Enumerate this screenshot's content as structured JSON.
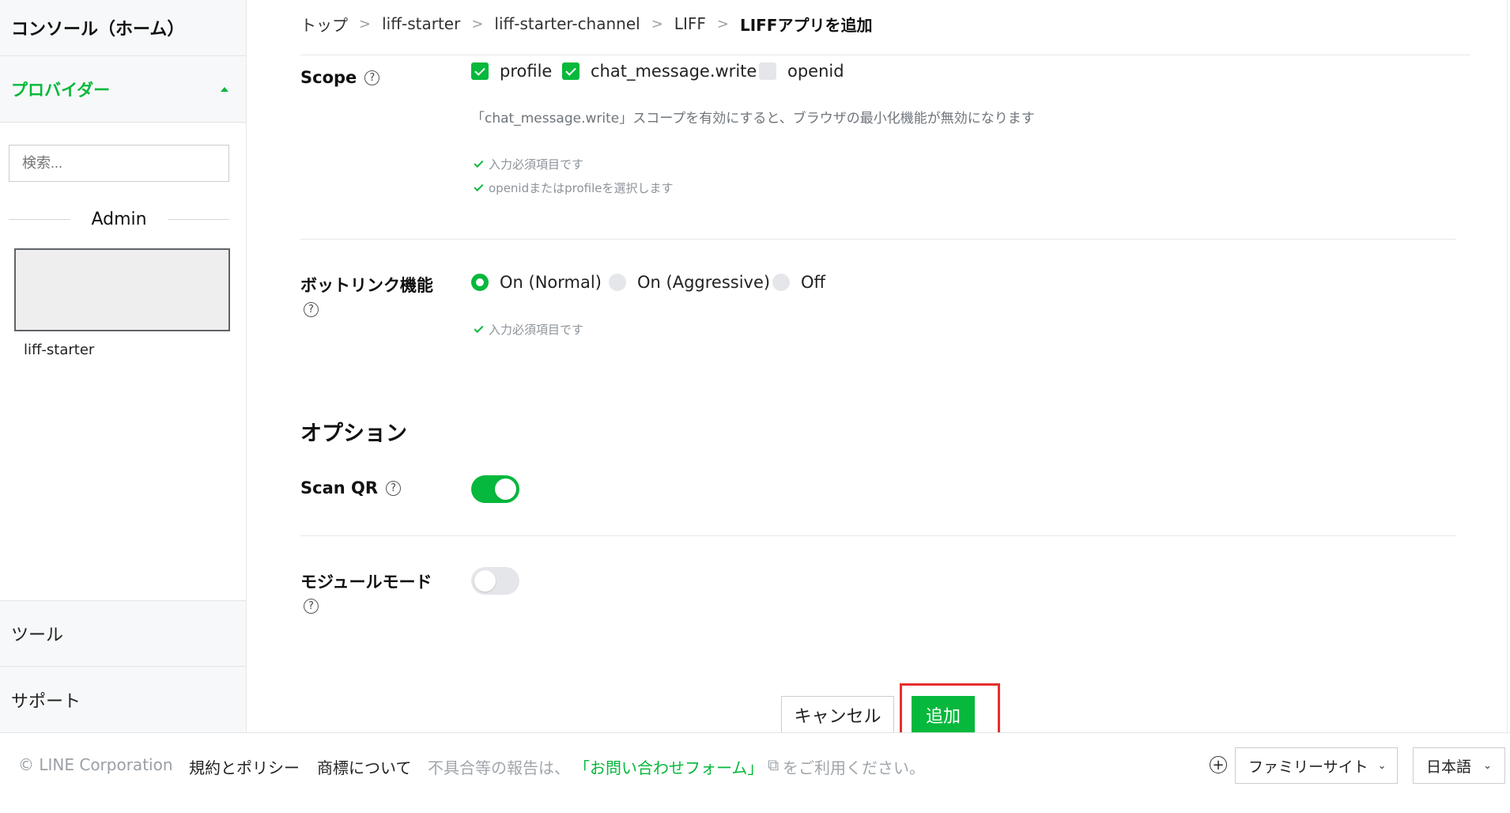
{
  "sidebar": {
    "home": "コンソール（ホーム）",
    "provider_header": "プロバイダー",
    "search_placeholder": "検索...",
    "section": "Admin",
    "provider_name": "liff-starter",
    "tools": "ツール",
    "support": "サポート"
  },
  "breadcrumb": [
    "トップ",
    "liff-starter",
    "liff-starter-channel",
    "LIFF",
    "LIFFアプリを追加"
  ],
  "scope": {
    "label": "Scope",
    "options": [
      {
        "label": "profile",
        "checked": true
      },
      {
        "label": "chat_message.write",
        "checked": true
      },
      {
        "label": "openid",
        "checked": false
      }
    ],
    "note": "「chat_message.write」スコープを有効にすると、ブラウザの最小化機能が無効になります",
    "validations": [
      "入力必須項目です",
      "openidまたはprofileを選択します"
    ]
  },
  "botlink": {
    "label": "ボットリンク機能",
    "options": [
      {
        "label": "On (Normal)",
        "selected": true
      },
      {
        "label": "On (Aggressive)",
        "selected": false
      },
      {
        "label": "Off",
        "selected": false
      }
    ],
    "validation": "入力必須項目です"
  },
  "options_section": {
    "title": "オプション",
    "scan_qr": {
      "label": "Scan QR",
      "on": true
    },
    "module_mode": {
      "label": "モジュールモード",
      "on": false
    }
  },
  "actions": {
    "cancel": "キャンセル",
    "add": "追加"
  },
  "footer": {
    "copyright": "© LINE Corporation",
    "terms": "規約とポリシー",
    "trademark": "商標について",
    "report_prefix": "不具合等の報告は、",
    "report_link": "「お問い合わせフォーム」",
    "report_suffix": "をご利用ください。",
    "family_site": "ファミリーサイト",
    "language": "日本語"
  },
  "colors": {
    "accent": "#06b83c",
    "highlight": "#e52f2f"
  },
  "help_glyph": "?",
  "ext_icon": "⧉"
}
